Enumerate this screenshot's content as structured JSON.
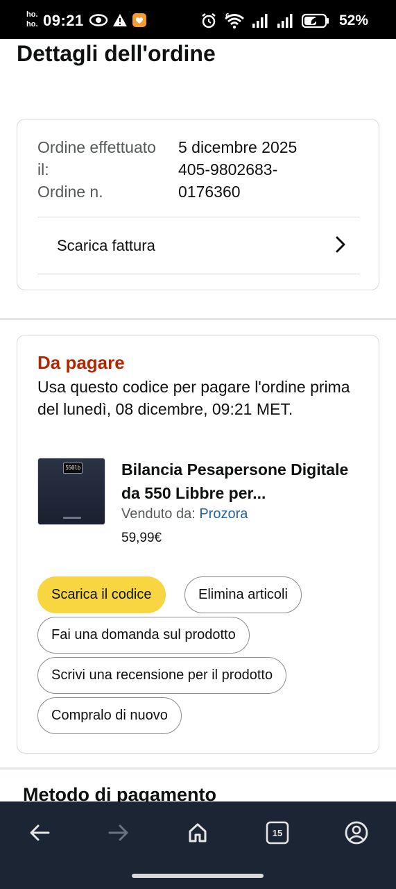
{
  "status_bar": {
    "carrier_label": "ho.\nho.",
    "time": "09:21",
    "battery_percent": "52%"
  },
  "page": {
    "title": "Dettagli dell'ordine"
  },
  "order_summary": {
    "labels": "Ordine effettuato il:\nOrdine n.",
    "values": "5 dicembre 2025\n405-9802683-\n0176360",
    "invoice_label": "Scarica fattura"
  },
  "payment": {
    "status": "Da pagare",
    "description": "Usa questo codice per pagare l'ordine prima del lunedì, 08 dicembre, 09:21 MET.",
    "product": {
      "title": "Bilancia Pesapersone Digitale da 550 Libbre per...",
      "sold_by_label": "Venduto da: ",
      "seller": "Prozora",
      "price": "59,99€",
      "display_text": "550lb"
    },
    "buttons": {
      "download_code": "Scarica il codice",
      "delete_items": "Elimina articoli",
      "ask_question": "Fai una domanda sul prodotto",
      "write_review": "Scrivi una recensione per il prodotto",
      "buy_again": "Compralo di nuovo"
    }
  },
  "next_section": {
    "title": "Metodo di pagamento"
  },
  "bottom_nav": {
    "tabs_count": "15"
  },
  "colors": {
    "accent_button": "#f7d642",
    "status_red": "#b12704",
    "link_blue": "#2162a1",
    "nav_background": "#1b2533"
  },
  "icons": [
    "eye-icon",
    "warning-icon",
    "heart-badge-icon",
    "alarm-icon",
    "wifi-icon",
    "signal-icon",
    "battery-icon",
    "chevron-right-icon",
    "back-arrow-icon",
    "forward-arrow-icon",
    "home-icon",
    "tabs-icon",
    "account-icon"
  ]
}
